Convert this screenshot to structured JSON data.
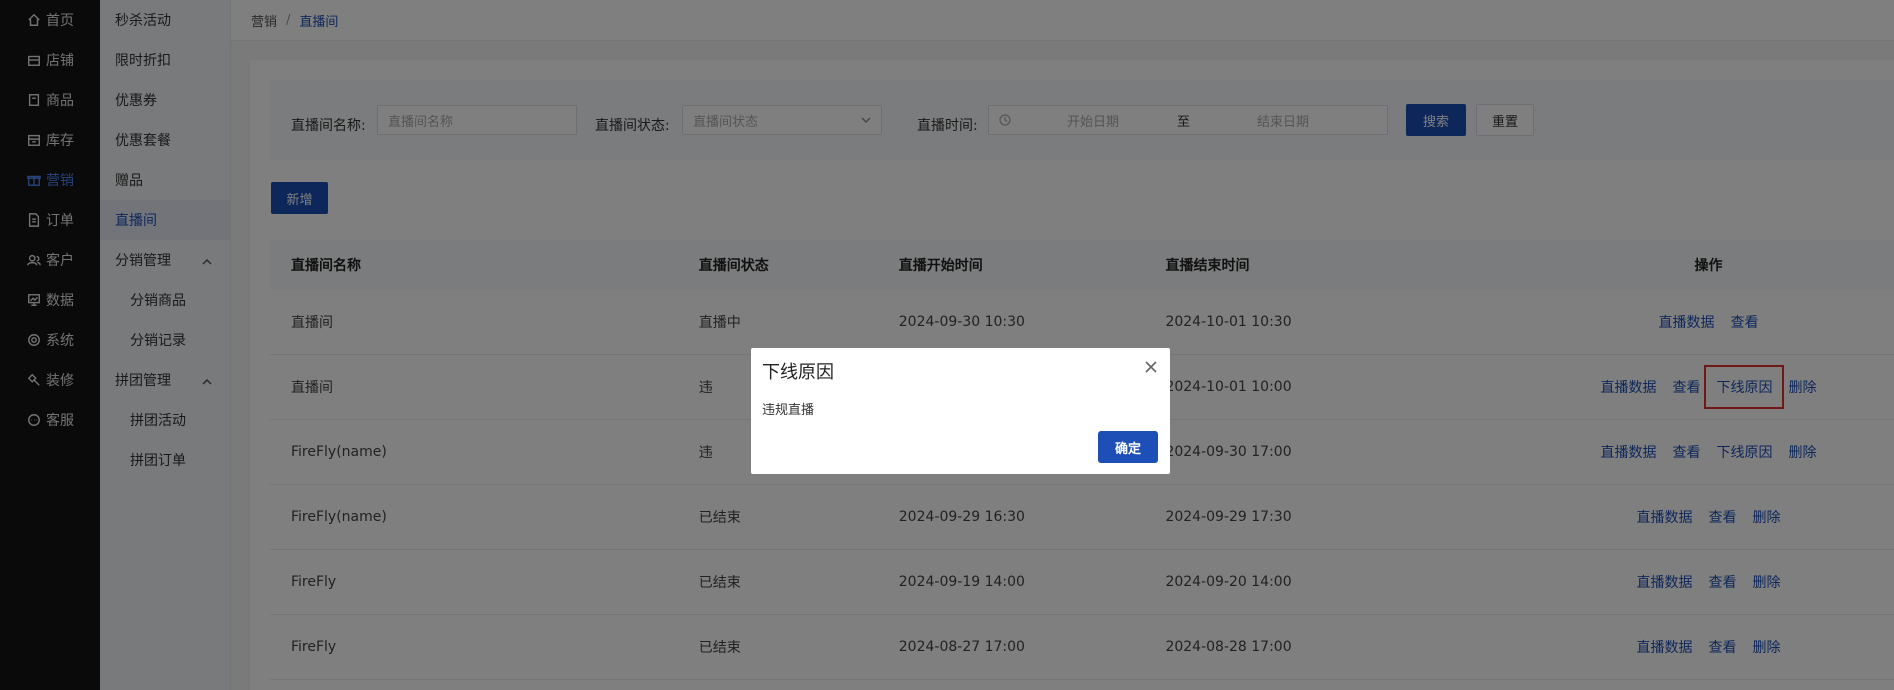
{
  "nav": {
    "items": [
      {
        "label": "首页",
        "icon": "home-icon"
      },
      {
        "label": "店铺",
        "icon": "store-icon"
      },
      {
        "label": "商品",
        "icon": "product-icon"
      },
      {
        "label": "库存",
        "icon": "inventory-icon"
      },
      {
        "label": "营销",
        "icon": "gift-icon"
      },
      {
        "label": "订单",
        "icon": "order-icon"
      },
      {
        "label": "客户",
        "icon": "customer-icon"
      },
      {
        "label": "数据",
        "icon": "data-icon"
      },
      {
        "label": "系统",
        "icon": "system-icon"
      },
      {
        "label": "装修",
        "icon": "decoration-icon"
      },
      {
        "label": "客服",
        "icon": "service-icon"
      }
    ]
  },
  "submenu": {
    "items": [
      {
        "label": "秒杀活动"
      },
      {
        "label": "限时折扣"
      },
      {
        "label": "优惠券"
      },
      {
        "label": "优惠套餐"
      },
      {
        "label": "赠品"
      },
      {
        "label": "直播间"
      },
      {
        "label": "分销管理"
      },
      {
        "label": "分销商品"
      },
      {
        "label": "分销记录"
      },
      {
        "label": "拼团管理"
      },
      {
        "label": "拼团活动"
      },
      {
        "label": "拼团订单"
      }
    ]
  },
  "breadcrumb": {
    "parent": "营销",
    "separator": "/",
    "current": "直播间"
  },
  "filters": {
    "name_label": "直播间名称:",
    "name_placeholder": "直播间名称",
    "status_label": "直播间状态:",
    "status_placeholder": "直播间状态",
    "time_label": "直播时间:",
    "start_placeholder": "开始日期",
    "range_sep": "至",
    "end_placeholder": "结束日期",
    "search_label": "搜索",
    "reset_label": "重置"
  },
  "toolbar": {
    "add_label": "新增"
  },
  "table": {
    "headers": [
      "直播间名称",
      "直播间状态",
      "直播开始时间",
      "直播结束时间",
      "操作"
    ],
    "rows": [
      {
        "name": "直播间",
        "status": "直播中",
        "start": "2024-09-30 10:30",
        "end": "2024-10-01 10:30",
        "actions": [
          "直播数据",
          "查看"
        ]
      },
      {
        "name": "直播间",
        "status": "违",
        "start": "",
        "end": "2024-10-01 10:00",
        "actions": [
          "直播数据",
          "查看",
          "下线原因",
          "删除"
        ]
      },
      {
        "name": "FireFly(name)",
        "status": "违",
        "start": "",
        "end": "2024-09-30 17:00",
        "actions": [
          "直播数据",
          "查看",
          "下线原因",
          "删除"
        ]
      },
      {
        "name": "FireFly(name)",
        "status": "已结束",
        "start": "2024-09-29 16:30",
        "end": "2024-09-29 17:30",
        "actions": [
          "直播数据",
          "查看",
          "删除"
        ]
      },
      {
        "name": "FireFly",
        "status": "已结束",
        "start": "2024-09-19 14:00",
        "end": "2024-09-20 14:00",
        "actions": [
          "直播数据",
          "查看",
          "删除"
        ]
      },
      {
        "name": "FireFly",
        "status": "已结束",
        "start": "2024-08-27 17:00",
        "end": "2024-08-28 17:00",
        "actions": [
          "直播数据",
          "查看",
          "删除"
        ]
      }
    ]
  },
  "modal": {
    "title": "下线原因",
    "body": "违规直播",
    "ok_label": "确定"
  },
  "colors": {
    "primary": "#1d4fb7",
    "highlight_box": "#e0302b",
    "sidebar_bg": "#141414"
  }
}
